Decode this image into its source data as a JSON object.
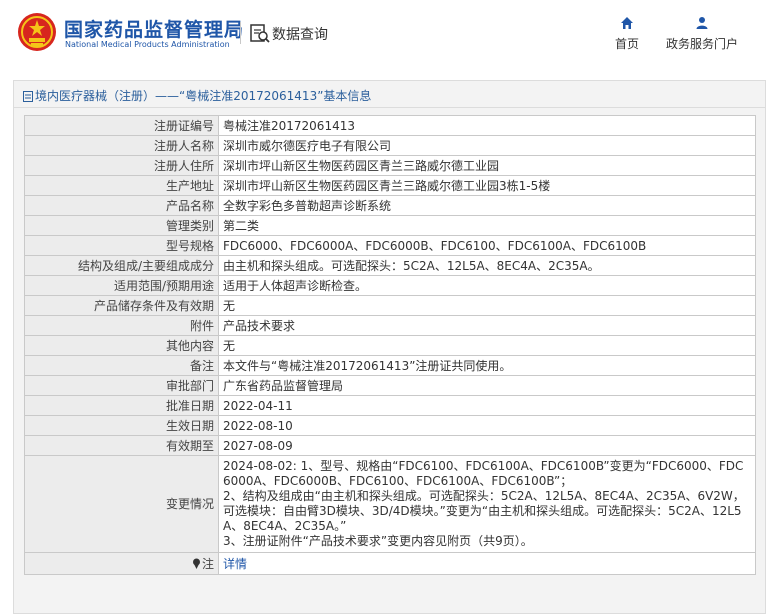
{
  "header": {
    "brand_cn": "国家药品监督管理局",
    "brand_en": "National Medical Products Administration",
    "data_query": "数据查询",
    "nav": [
      {
        "label": "首页",
        "icon": "home-icon"
      },
      {
        "label": "政务服务门户",
        "icon": "user-icon"
      }
    ]
  },
  "breadcrumb": "境内医疗器械（注册）——“粤械注准20172061413”基本信息",
  "rows": [
    {
      "label": "注册证编号",
      "value": "粤械注准20172061413"
    },
    {
      "label": "注册人名称",
      "value": "深圳市威尔德医疗电子有限公司"
    },
    {
      "label": "注册人住所",
      "value": "深圳市坪山新区生物医药园区青兰三路威尔德工业园"
    },
    {
      "label": "生产地址",
      "value": "深圳市坪山新区生物医药园区青兰三路威尔德工业园3栋1-5楼"
    },
    {
      "label": "产品名称",
      "value": "全数字彩色多普勒超声诊断系统"
    },
    {
      "label": "管理类别",
      "value": "第二类"
    },
    {
      "label": "型号规格",
      "value": "FDC6000、FDC6000A、FDC6000B、FDC6100、FDC6100A、FDC6100B"
    },
    {
      "label": "结构及组成/主要组成成分",
      "value": "由主机和探头组成。可选配探头：5C2A、12L5A、8EC4A、2C35A。"
    },
    {
      "label": "适用范围/预期用途",
      "value": "适用于人体超声诊断检查。"
    },
    {
      "label": "产品储存条件及有效期",
      "value": "无"
    },
    {
      "label": "附件",
      "value": "产品技术要求"
    },
    {
      "label": "其他内容",
      "value": "无"
    },
    {
      "label": "备注",
      "value": "本文件与“粤械注准20172061413”注册证共同使用。"
    },
    {
      "label": "审批部门",
      "value": "广东省药品监督管理局"
    },
    {
      "label": "批准日期",
      "value": "2022-04-11"
    },
    {
      "label": "生效日期",
      "value": "2022-08-10"
    },
    {
      "label": "有效期至",
      "value": "2027-08-09"
    }
  ],
  "change": {
    "label": "变更情况",
    "lines": [
      "2024-08-02: 1、型号、规格由“FDC6100、FDC6100A、FDC6100B”变更为“FDC6000、FDC6000A、FDC6000B、FDC6100、FDC6100A、FDC6100B”；",
      "2、结构及组成由“由主机和探头组成。可选配探头：5C2A、12L5A、8EC4A、2C35A、6V2W，可选模块：自由臂3D模块、3D/4D模块。”变更为“由主机和探头组成。可选配探头：5C2A、12L5A、8EC4A、2C35A。”",
      "3、注册证附件“产品技术要求”变更内容见附页（共9页）。"
    ]
  },
  "note": {
    "label": "注",
    "link": "详情",
    "icon": "pin-icon"
  }
}
